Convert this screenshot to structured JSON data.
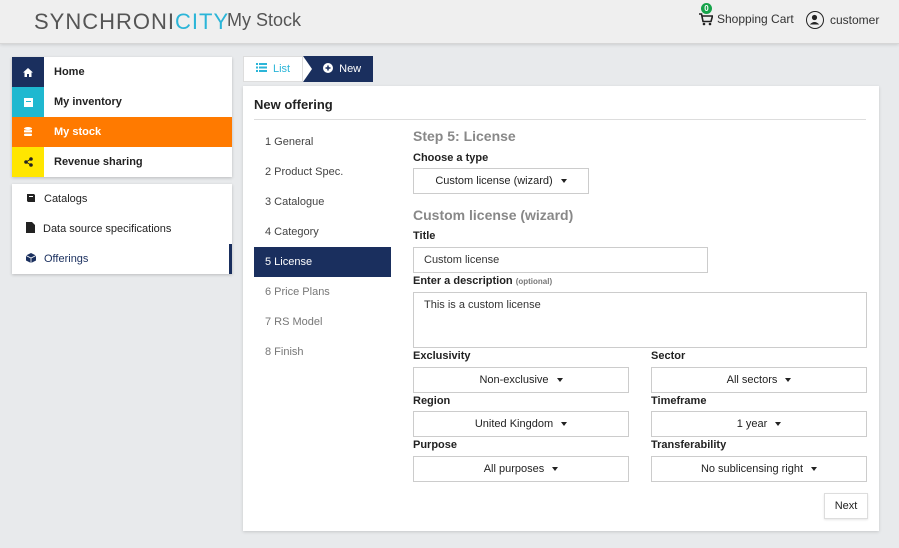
{
  "header": {
    "logo_main": "SYNCHRONI",
    "logo_accent": "CITY",
    "app_title": "My Stock",
    "cart_count": "0",
    "cart_label": "Shopping Cart",
    "user_label": "customer"
  },
  "nav": {
    "items": [
      {
        "label": "Home",
        "icon": "home-icon",
        "color": "#1a2f5e"
      },
      {
        "label": "My inventory",
        "icon": "inventory-icon",
        "color": "#1fb8d0"
      },
      {
        "label": "My stock",
        "icon": "database-icon",
        "color": "#ff7a00"
      },
      {
        "label": "Revenue sharing",
        "icon": "share-icon",
        "color": "#ffe600"
      }
    ],
    "sub": [
      {
        "label": "Catalogs",
        "icon": "book-icon"
      },
      {
        "label": "Data source specifications",
        "icon": "file-icon"
      },
      {
        "label": "Offerings",
        "icon": "cube-icon"
      }
    ]
  },
  "toolbar": {
    "list_label": "List",
    "new_label": "New"
  },
  "panel": {
    "title": "New offering",
    "steps": [
      "1 General",
      "2 Product Spec.",
      "3 Catalogue",
      "4 Category",
      "5 License",
      "6 Price Plans",
      "7 RS Model",
      "8 Finish"
    ],
    "active_step": "5 License"
  },
  "form": {
    "step_heading": "Step 5: License",
    "type_label": "Choose a type",
    "type_value": "Custom license (wizard)",
    "wizard_heading": "Custom license (wizard)",
    "title_label": "Title",
    "title_value": "Custom license",
    "desc_label": "Enter a description",
    "desc_optional": "(optional)",
    "desc_value": "This is a custom license",
    "exclusivity_label": "Exclusivity",
    "exclusivity_value": "Non-exclusive",
    "sector_label": "Sector",
    "sector_value": "All sectors",
    "region_label": "Region",
    "region_value": "United Kingdom",
    "timeframe_label": "Timeframe",
    "timeframe_value": "1 year",
    "purpose_label": "Purpose",
    "purpose_value": "All purposes",
    "transfer_label": "Transferability",
    "transfer_value": "No sublicensing right",
    "next_label": "Next"
  }
}
